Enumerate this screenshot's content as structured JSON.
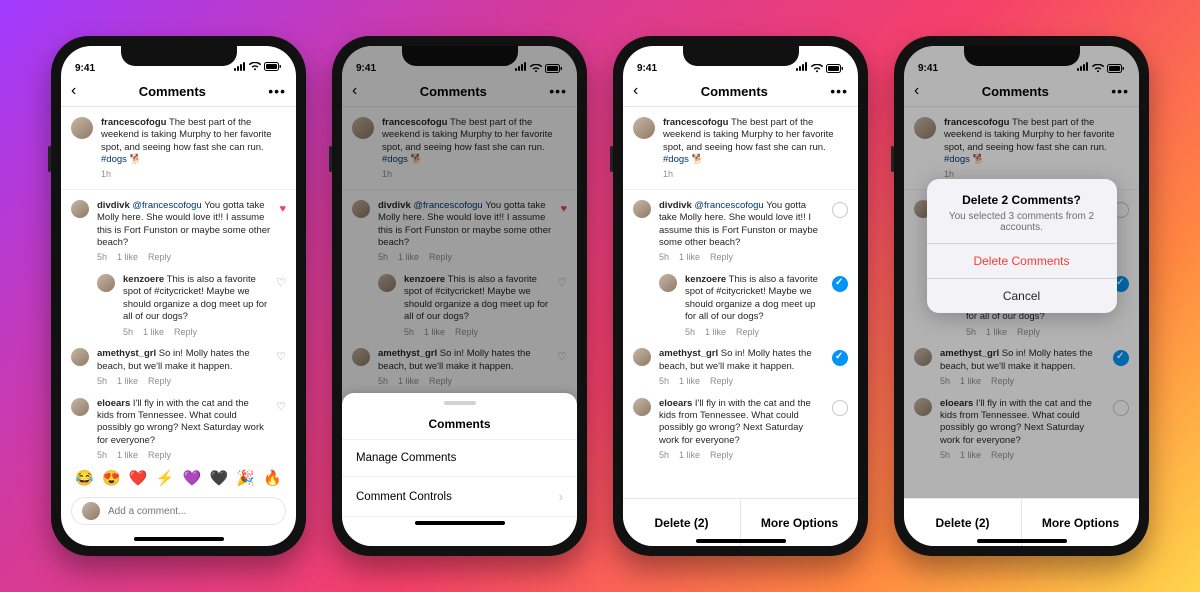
{
  "statusbar": {
    "time": "9:41"
  },
  "navbar": {
    "title": "Comments"
  },
  "post": {
    "author": "francescofogu",
    "text": "The best part of the weekend is taking Murphy to her favorite spot, and seeing how fast she can run.",
    "hashtag": "#dogs",
    "emoji": "🐕",
    "time": "1h"
  },
  "comments": [
    {
      "author": "divdivk",
      "mention": "@francescofogu",
      "text": "You gotta take Molly here. She would love it!! I assume this is Fort Funston or maybe some other beach?",
      "time": "5h",
      "likes": "1 like",
      "reply": "Reply",
      "liked": true
    },
    {
      "reply_indent": true,
      "author": "kenzoere",
      "text": "This is also a favorite spot of #citycricket! Maybe we should organize a dog meet up for all of our dogs?",
      "time": "5h",
      "likes": "1 like",
      "reply": "Reply"
    },
    {
      "author": "amethyst_grl",
      "text": "So in! Molly hates the beach, but we'll make it happen.",
      "time": "5h",
      "likes": "1 like",
      "reply": "Reply"
    },
    {
      "author": "eloears",
      "text": "I'll fly in with the cat and the kids from Tennessee. What could possibly go wrong? Next Saturday work for everyone?",
      "time": "5h",
      "likes": "1 like",
      "reply": "Reply"
    }
  ],
  "composer": {
    "placeholder": "Add a comment..."
  },
  "emoji_row": [
    "😂",
    "😍",
    "❤️",
    "⚡",
    "💜",
    "🖤",
    "🎉",
    "🔥"
  ],
  "sheet": {
    "title": "Comments",
    "rows": [
      "Manage Comments",
      "Comment Controls"
    ]
  },
  "manage_bar": {
    "delete": "Delete (2)",
    "more": "More Options"
  },
  "alert": {
    "title": "Delete 2 Comments?",
    "message": "You selected 3 comments from 2 accounts.",
    "destructive": "Delete Comments",
    "cancel": "Cancel"
  },
  "selection": [
    false,
    true,
    true,
    false
  ]
}
